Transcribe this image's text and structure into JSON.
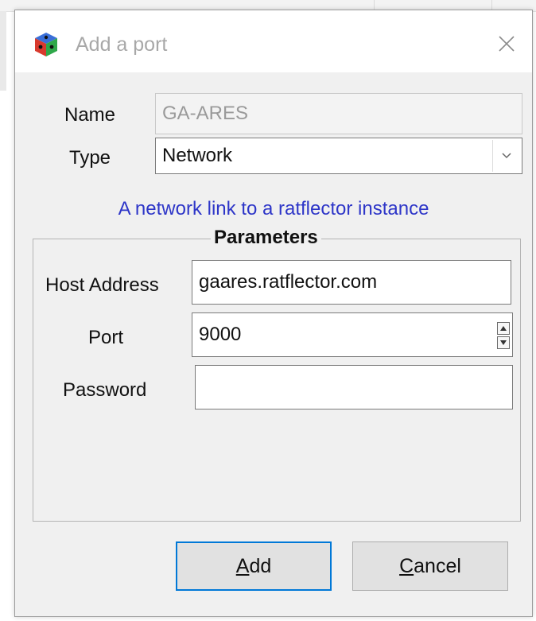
{
  "window": {
    "title": "Add a port"
  },
  "form": {
    "name_label": "Name",
    "name_value": "GA-ARES",
    "type_label": "Type",
    "type_value": "Network",
    "type_description": "A network link to a ratflector instance"
  },
  "parameters": {
    "title": "Parameters",
    "host_label": "Host Address",
    "host_value": "gaares.ratflector.com",
    "port_label": "Port",
    "port_value": "9000",
    "password_label": "Password",
    "password_value": ""
  },
  "buttons": {
    "add_mnemonic": "A",
    "add_rest": "dd",
    "cancel_mnemonic": "C",
    "cancel_rest": "ancel"
  },
  "colors": {
    "info_text": "#2e36c8",
    "default_button_border": "#0078d7"
  },
  "icons": {
    "app": "cube-icon",
    "close": "close-icon",
    "dropdown": "chevron-down-icon",
    "spin_up": "spin-up-icon",
    "spin_down": "spin-down-icon"
  }
}
